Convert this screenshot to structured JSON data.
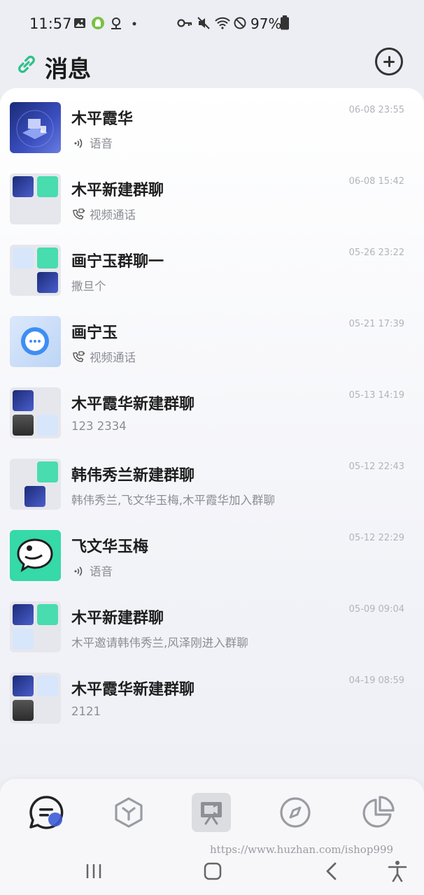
{
  "status_bar": {
    "time": "11:57",
    "battery": "97%"
  },
  "header": {
    "title": "消息",
    "link_icon": "link-icon",
    "add_icon": "plus-circle-icon"
  },
  "conversations": [
    {
      "name": "木平霞华",
      "time": "06-08 23:55",
      "preview": "语音",
      "preview_icon": "voice-icon"
    },
    {
      "name": "木平新建群聊",
      "time": "06-08 15:42",
      "preview": "视频通话",
      "preview_icon": "video-call-icon"
    },
    {
      "name": "画宁玉群聊一",
      "time": "05-26 23:22",
      "preview": "撒旦个",
      "preview_icon": ""
    },
    {
      "name": "画宁玉",
      "time": "05-21 17:39",
      "preview": "视频通话",
      "preview_icon": "video-call-icon"
    },
    {
      "name": "木平霞华新建群聊",
      "time": "05-13 14:19",
      "preview": "123 2334",
      "preview_icon": ""
    },
    {
      "name": "韩伟秀兰新建群聊",
      "time": "05-12 22:43",
      "preview": "韩伟秀兰,飞文华玉梅,木平霞华加入群聊",
      "preview_icon": ""
    },
    {
      "name": "飞文华玉梅",
      "time": "05-12 22:29",
      "preview": "语音",
      "preview_icon": "voice-icon"
    },
    {
      "name": "木平新建群聊",
      "time": "05-09 09:04",
      "preview": "木平邀请韩伟秀兰,风泽刚进入群聊",
      "preview_icon": ""
    },
    {
      "name": "木平霞华新建群聊",
      "time": "04-19 08:59",
      "preview": "2121",
      "preview_icon": ""
    }
  ],
  "bottom_nav": [
    {
      "icon": "chat-icon",
      "active": true
    },
    {
      "icon": "cube-icon",
      "active": false
    },
    {
      "icon": "video-screen-icon",
      "active": false
    },
    {
      "icon": "compass-icon",
      "active": false
    },
    {
      "icon": "pie-chart-icon",
      "active": false
    }
  ],
  "watermark": "https://www.huzhan.com/ishop999",
  "colors": {
    "accent_green": "#2ec08a",
    "chat_blue": "#3d5bd6"
  }
}
